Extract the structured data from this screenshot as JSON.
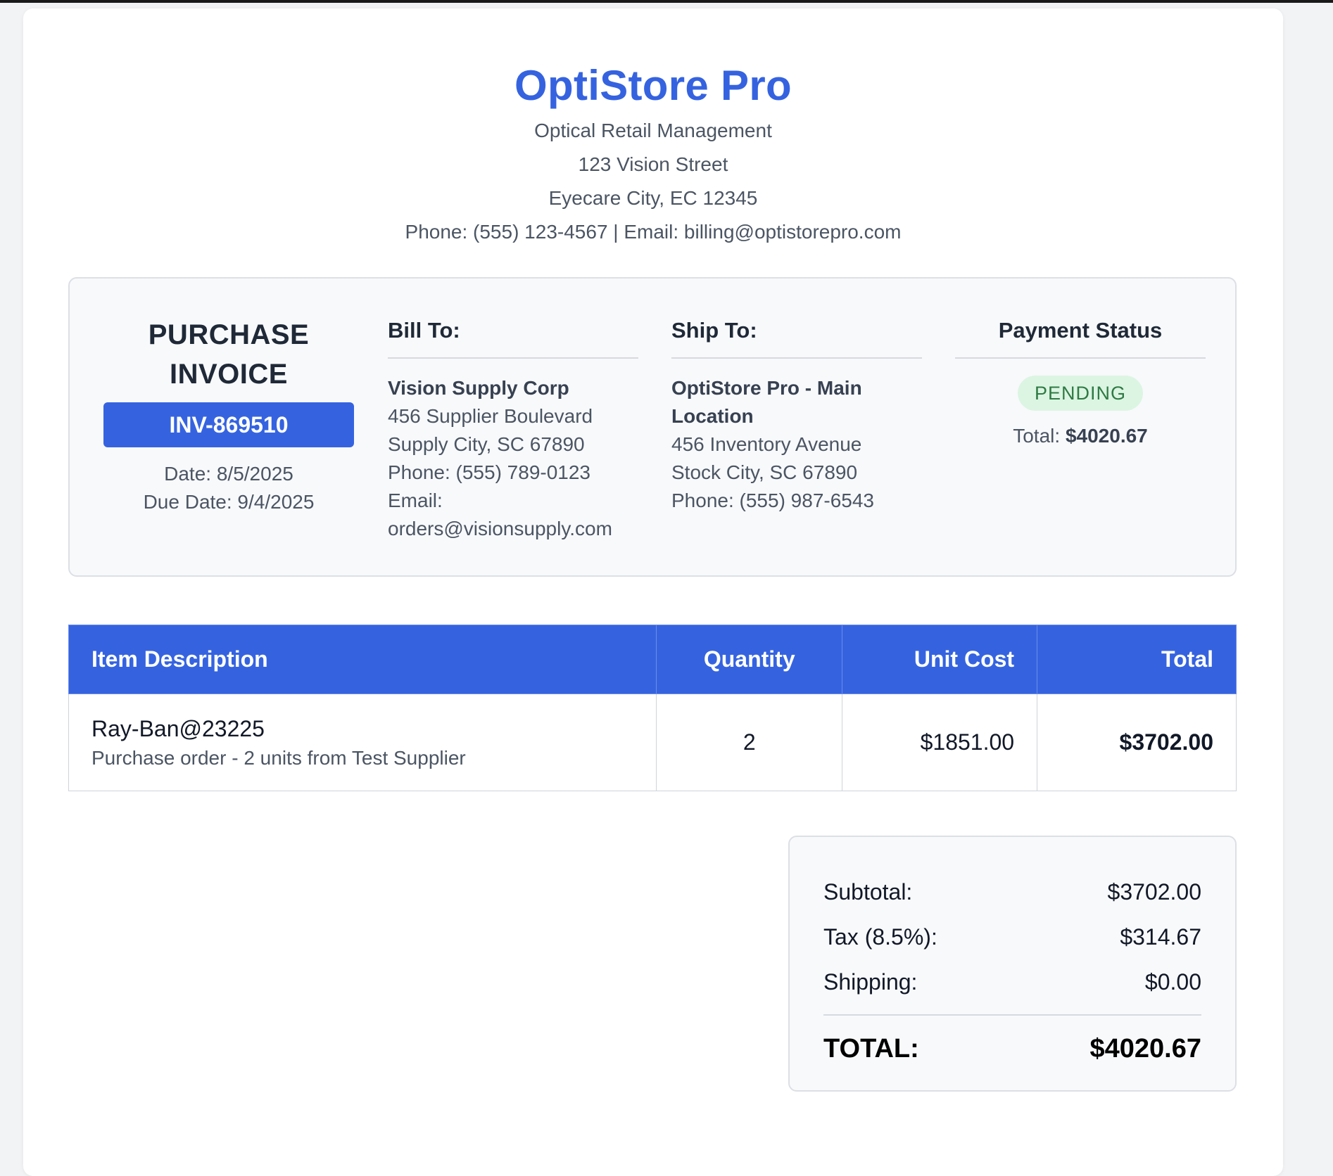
{
  "company": {
    "name": "OptiStore Pro",
    "tagline": "Optical Retail Management",
    "address1": "123 Vision Street",
    "address2": "Eyecare City, EC 12345",
    "contact": "Phone: (555) 123-4567 | Email: billing@optistorepro.com"
  },
  "invoice": {
    "title_line1": "PURCHASE",
    "title_line2": "INVOICE",
    "number": "INV-869510",
    "date": "Date: 8/5/2025",
    "due_date": "Due Date: 9/4/2025"
  },
  "bill_to": {
    "heading": "Bill To:",
    "name": "Vision Supply Corp",
    "lines": [
      "456 Supplier Boulevard",
      "Supply City, SC 67890",
      "Phone: (555) 789-0123",
      "Email:",
      "orders@visionsupply.com"
    ]
  },
  "ship_to": {
    "heading": "Ship To:",
    "name": "OptiStore Pro - Main Location",
    "lines": [
      "456 Inventory Avenue",
      "Stock City, SC 67890",
      "Phone: (555) 987-6543"
    ]
  },
  "payment": {
    "heading": "Payment Status",
    "status": "PENDING",
    "total_label": "Total:",
    "total_value": "$4020.67"
  },
  "items_table": {
    "headers": [
      "Item Description",
      "Quantity",
      "Unit Cost",
      "Total"
    ],
    "rows": [
      {
        "name": "Ray-Ban@23225",
        "description": "Purchase order - 2 units from Test Supplier",
        "quantity": "2",
        "unit_cost": "$1851.00",
        "total": "$3702.00"
      }
    ]
  },
  "totals": {
    "subtotal_label": "Subtotal:",
    "subtotal_value": "$3702.00",
    "tax_label": "Tax (8.5%):",
    "tax_value": "$314.67",
    "shipping_label": "Shipping:",
    "shipping_value": "$0.00",
    "grand_label": "TOTAL:",
    "grand_value": "$4020.67"
  },
  "colors": {
    "brand": "#3563e0",
    "status_bg": "#dcf5e3",
    "status_text": "#2f7a43"
  }
}
